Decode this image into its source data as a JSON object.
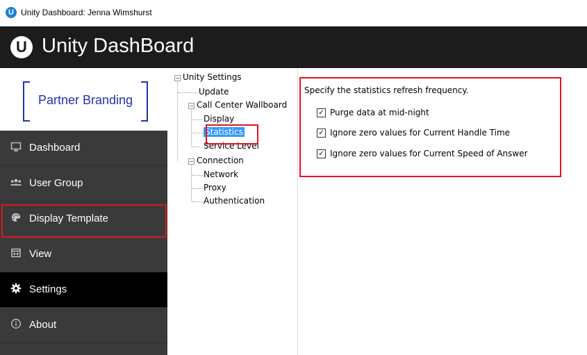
{
  "window": {
    "title": "Unity Dashboard: Jenna Wimshurst",
    "icon_letter": "U"
  },
  "header": {
    "logo_letter": "U",
    "app_name": "Unity DashBoard"
  },
  "brand": {
    "text": "Partner Branding"
  },
  "sidebar": {
    "items": [
      {
        "label": "Dashboard",
        "icon": "monitor-icon"
      },
      {
        "label": "User Group",
        "icon": "users-icon"
      },
      {
        "label": "Display Template",
        "icon": "palette-icon"
      },
      {
        "label": "View",
        "icon": "calendar-view-icon"
      },
      {
        "label": "Settings",
        "icon": "gear-icon",
        "active": true
      },
      {
        "label": "About",
        "icon": "info-icon"
      }
    ]
  },
  "tree": {
    "root": "Unity Settings",
    "update": "Update",
    "wallboard": "Call Center Wallboard",
    "display": "Display",
    "statistics": "Statistics",
    "service_level": "Service Level",
    "connection": "Connection",
    "network": "Network",
    "proxy": "Proxy",
    "authentication": "Authentication"
  },
  "statistics_panel": {
    "intro": "Specify the statistics refresh frequency.",
    "options": [
      {
        "label": "Purge data at mid-night",
        "checked": true
      },
      {
        "label": "Ignore zero values for Current Handle Time",
        "checked": true
      },
      {
        "label": "Ignore zero values for Current Speed of Answer",
        "checked": true
      }
    ]
  },
  "colors": {
    "header_bg": "#1c1c1c",
    "sidebar_bg": "#3a3a3a",
    "active_bg": "#000000",
    "highlight": "#e0141e",
    "brand": "#2233aa",
    "selection": "#3399ff"
  }
}
